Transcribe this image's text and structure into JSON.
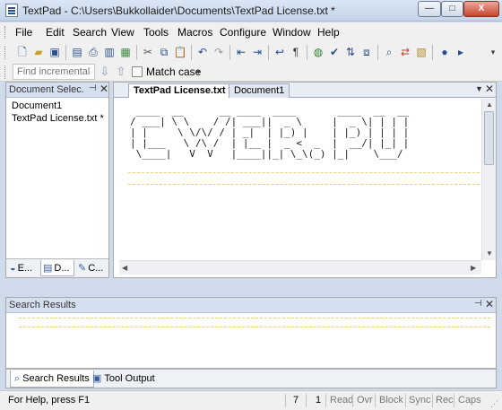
{
  "window": {
    "title": "TextPad - C:\\Users\\Bukkollaider\\Documents\\TextPad License.txt *",
    "minimize": "—",
    "maximize": "□",
    "close": "X"
  },
  "menu": [
    "File",
    "Edit",
    "Search",
    "View",
    "Tools",
    "Macros",
    "Configure",
    "Window",
    "Help"
  ],
  "toolbar_icons": [
    "new-file-icon",
    "open-file-icon",
    "save-icon",
    "save-all-icon",
    "print-icon",
    "print-preview-icon",
    "document-properties-icon",
    "cut-icon",
    "copy-icon",
    "paste-icon",
    "undo-icon",
    "redo-icon",
    "indent-icon",
    "outdent-icon",
    "word-wrap-icon",
    "visible-spaces-icon",
    "browser-icon",
    "spelling-icon",
    "sort-icon",
    "compare-icon",
    "find-icon",
    "replace-icon",
    "find-in-files-icon",
    "record-macro-icon",
    "play-macro-icon"
  ],
  "findbar": {
    "placeholder": "Find incrementally",
    "down_arrow": "⇩",
    "up_arrow": "⇧",
    "match_case": "Match case"
  },
  "document_selector": {
    "title": "Document Selec...",
    "pin": "⊣",
    "close": "✕",
    "items": [
      "Document1",
      "TextPad License.txt *"
    ],
    "tabs": [
      "E...",
      "D...",
      "C..."
    ]
  },
  "editor": {
    "tabs": [
      {
        "label": "TextPad License.txt *",
        "active": true
      },
      {
        "label": "Document1",
        "active": false
      }
    ],
    "content_lines": [
      " ____  __      __ ____  ____       ____  __  __",
      "/ ___| \\ \\    / /| ___||  _ \\     |  _ \\| | | |",
      "| |     \\ \\/\\/ / | _|  | |_) |    | |_) | | | |",
      "| |___   \\ /\\ /  | |__ |  _ <  _  |  __/| |_| |",
      " \\____|   V  V   |____||_| \\_\\(_) |_|    \\___/ "
    ]
  },
  "search_results": {
    "title": "Search Results",
    "pin": "⊣",
    "close": "✕"
  },
  "bottom_tabs": [
    "Search Results",
    "Tool Output"
  ],
  "status": {
    "help": "For Help, press F1",
    "line": "7",
    "column": "1",
    "indicators": [
      "Read",
      "Ovr",
      "Block",
      "Sync",
      "Rec",
      "Caps"
    ]
  }
}
